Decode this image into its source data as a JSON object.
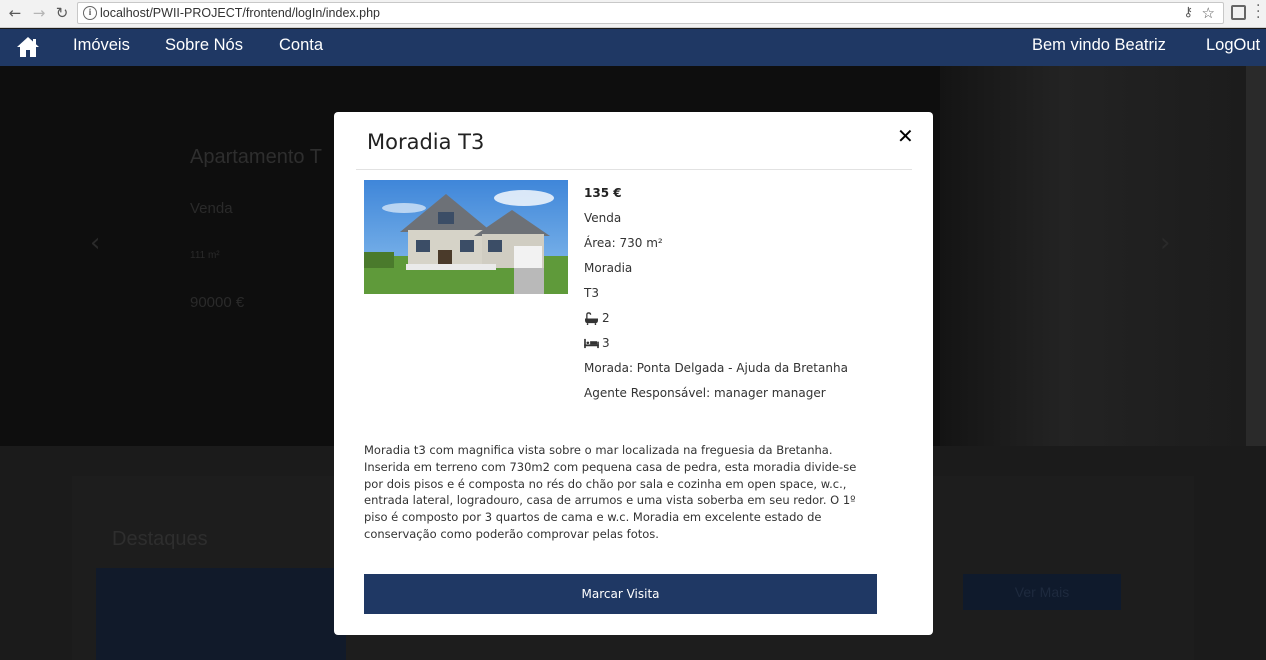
{
  "browser": {
    "url": "localhost/PWII-PROJECT/frontend/logIn/index.php"
  },
  "navbar": {
    "links": [
      "Imóveis",
      "Sobre Nós",
      "Conta"
    ],
    "welcome": "Bem vindo Beatriz",
    "logout": "LogOut",
    "brand_color": "#1f3864"
  },
  "background": {
    "hero_title": "Apartamento T",
    "hero_type": "Venda",
    "hero_area": "111 m²",
    "hero_price": "90000 €",
    "section_title": "Destaques",
    "more_button": "Ver Mais"
  },
  "modal": {
    "title": "Moradia T3",
    "price": "135 €",
    "transaction": "Venda",
    "area": "Área: 730 m²",
    "property_type": "Moradia",
    "typology": "T3",
    "bathrooms": "2",
    "bedrooms": "3",
    "address": "Morada: Ponta Delgada - Ajuda da Bretanha",
    "agent": "Agente Responsável: manager manager",
    "description": "Moradia t3 com magnifica vista sobre o mar localizada na freguesia da Bretanha. Inserida em terreno com 730m2 com pequena casa de pedra, esta moradia divide-se por dois pisos e é composta no rés do chão por sala e cozinha em open space, w.c., entrada lateral, logradouro, casa de arrumos e uma vista soberba em seu redor. O 1º piso é composto por 3 quartos de cama e w.c. Moradia em excelente estado de conservação como poderão comprovar pelas fotos.",
    "book_button": "Marcar Visita"
  }
}
